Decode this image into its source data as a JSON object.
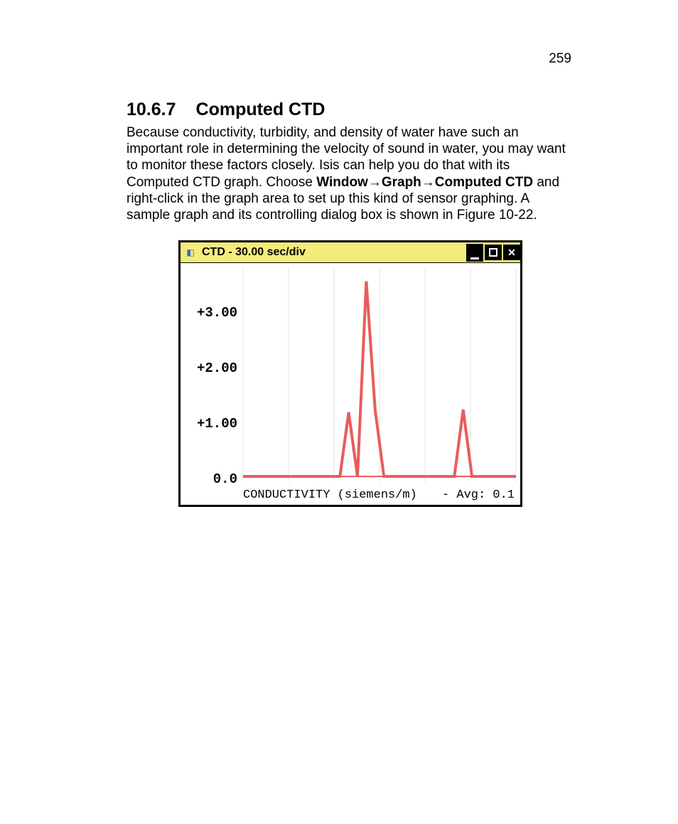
{
  "page_number": "259",
  "heading_number": "10.6.7",
  "heading_title": "Computed CTD",
  "paragraph_pre": "Because conductivity, turbidity, and density of water have such an important role in determining the velocity of sound in water, you may want to monitor these factors closely. Isis can help you do that with its Computed CTD graph. Choose ",
  "menu_path": "Window→Graph→Computed CTD",
  "paragraph_post": " and right-click in the graph area to set up this kind of sensor graphing. A sample graph and its controlling dialog box is shown in Figure 10-22.",
  "window": {
    "title_prefix": "CTD",
    "title_sep": " - ",
    "title_rate": "30.00 sec/div",
    "xlabel_left": "CONDUCTIVITY (siemens/m)",
    "xlabel_right": "- Avg: 0.1"
  },
  "chart_data": {
    "type": "line",
    "title": "CTD - 30.00 sec/div",
    "xlabel": "CONDUCTIVITY (siemens/m)",
    "ylabel": "",
    "ylim": [
      0,
      3.8
    ],
    "y_ticks": [
      "+3.00",
      "+2.00",
      "+1.00",
      "0.0"
    ],
    "annotation": "- Avg: 0.1",
    "series": [
      {
        "name": "Conductivity",
        "x": [
          0,
          1,
          2,
          3,
          4,
          5,
          6,
          7,
          8,
          9,
          10,
          11,
          12,
          13,
          14,
          15,
          16,
          17,
          18,
          19,
          20,
          21,
          22,
          23,
          24,
          25,
          26,
          27,
          28,
          29,
          30,
          31
        ],
        "values": [
          0.05,
          0.05,
          0.05,
          0.05,
          0.05,
          0.05,
          0.05,
          0.05,
          0.05,
          0.05,
          0.05,
          0.05,
          1.2,
          0.05,
          3.55,
          1.25,
          0.05,
          0.05,
          0.05,
          0.05,
          0.05,
          0.05,
          0.05,
          0.05,
          0.05,
          1.25,
          0.05,
          0.05,
          0.05,
          0.05,
          0.05,
          0.05
        ]
      }
    ]
  }
}
